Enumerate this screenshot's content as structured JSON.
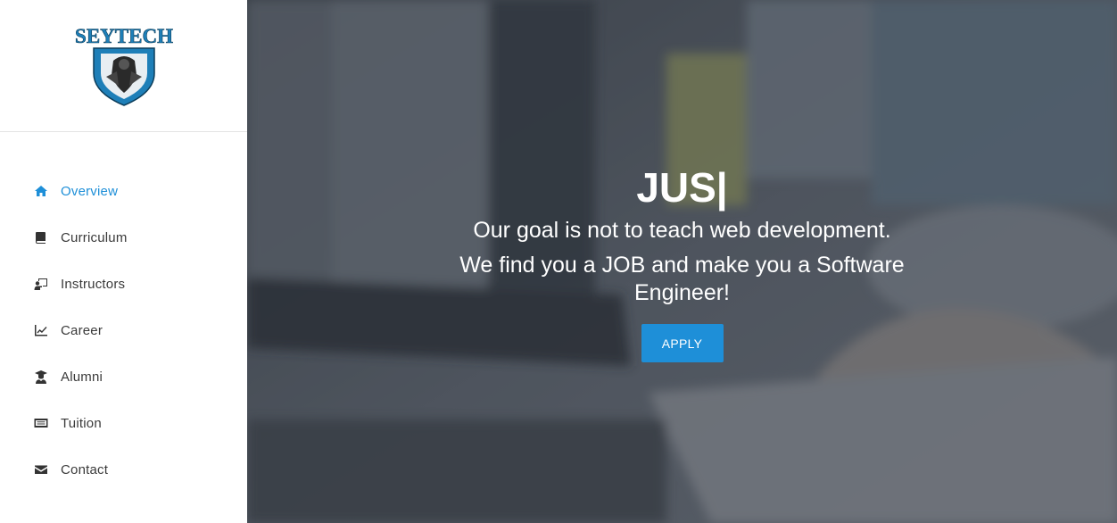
{
  "brand": {
    "logo_text": "SEYTECH"
  },
  "sidebar": {
    "items": [
      {
        "label": "Overview",
        "icon": "home-icon",
        "active": true
      },
      {
        "label": "Curriculum",
        "icon": "book-icon"
      },
      {
        "label": "Instructors",
        "icon": "chalkboard-teacher-icon"
      },
      {
        "label": "Career",
        "icon": "line-chart-icon"
      },
      {
        "label": "Alumni",
        "icon": "graduate-icon"
      },
      {
        "label": "Tuition",
        "icon": "money-bill-icon"
      },
      {
        "label": "Contact",
        "icon": "envelope-icon"
      }
    ]
  },
  "hero": {
    "title": "JUS|",
    "line1": "Our goal is not to teach web development.",
    "line2": "We find you a JOB and make you a Software Engineer!",
    "button_label": "APPLY"
  },
  "colors": {
    "accent": "#1e8fd8",
    "text": "#3a3a3a",
    "divider": "#e4e4e4",
    "logo_blue": "#1e7fb8"
  }
}
